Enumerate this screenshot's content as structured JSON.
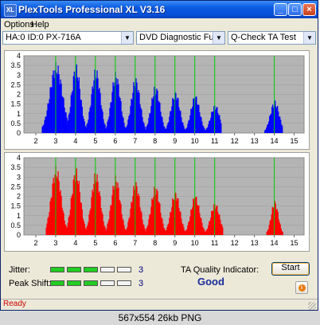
{
  "window": {
    "title": "PlexTools Professional XL V3.16",
    "icon_label": "XL"
  },
  "title_buttons": {
    "minimize": "_",
    "maximize": "□",
    "close": "×"
  },
  "menu": [
    "Options",
    "Help"
  ],
  "selectors": {
    "drive": "HA:0 ID:0  PX-716A",
    "function": "DVD Diagnostic Functions",
    "test": "Q-Check TA Test"
  },
  "colors": {
    "chart_bg": "#b4b4b4",
    "blue_series": "#0000ff",
    "red_series": "#ff0000",
    "peak_line": "#00cc00"
  },
  "chart_data": [
    {
      "type": "area",
      "color": "blue",
      "ylim": [
        0,
        4
      ],
      "xlim": [
        1.4,
        15.5
      ],
      "y_ticks": [
        "4",
        "3.5",
        "3",
        "2.5",
        "2",
        "1.5",
        "1",
        "0.5",
        "0"
      ],
      "x_ticks": [
        "2",
        "3",
        "4",
        "5",
        "6",
        "7",
        "8",
        "9",
        "10",
        "11",
        "12",
        "13",
        "14",
        "15"
      ],
      "peaks": [
        {
          "x": 3,
          "y": 3.7,
          "start": 2.3,
          "end": 3.55
        },
        {
          "x": 4,
          "y": 3.6,
          "start": 3.55,
          "end": 4.5
        },
        {
          "x": 5,
          "y": 3.4,
          "start": 4.5,
          "end": 5.5
        },
        {
          "x": 6,
          "y": 3.2,
          "start": 5.5,
          "end": 6.5
        },
        {
          "x": 7,
          "y": 2.9,
          "start": 6.5,
          "end": 7.5
        },
        {
          "x": 8,
          "y": 2.5,
          "start": 7.5,
          "end": 8.5
        },
        {
          "x": 9,
          "y": 2.2,
          "start": 8.5,
          "end": 9.5
        },
        {
          "x": 10,
          "y": 2.0,
          "start": 9.5,
          "end": 10.5
        },
        {
          "x": 11,
          "y": 1.5,
          "start": 10.5,
          "end": 11.3
        },
        {
          "x": 14,
          "y": 1.7,
          "start": 13.5,
          "end": 14.4
        }
      ],
      "peak_lines": [
        3,
        4,
        5,
        6,
        7,
        8,
        9,
        10,
        11,
        14
      ]
    },
    {
      "type": "area",
      "color": "red",
      "ylim": [
        0,
        4
      ],
      "xlim": [
        1.4,
        15.5
      ],
      "y_ticks": [
        "4",
        "3.5",
        "3",
        "2.5",
        "2",
        "1.5",
        "1",
        "0.5",
        "0"
      ],
      "x_ticks": [
        "2",
        "3",
        "4",
        "5",
        "6",
        "7",
        "8",
        "9",
        "10",
        "11",
        "12",
        "13",
        "14",
        "15"
      ],
      "peaks": [
        {
          "x": 3,
          "y": 3.6,
          "start": 2.5,
          "end": 3.55
        },
        {
          "x": 4,
          "y": 3.5,
          "start": 3.55,
          "end": 4.5
        },
        {
          "x": 5,
          "y": 3.3,
          "start": 4.5,
          "end": 5.5
        },
        {
          "x": 6,
          "y": 3.1,
          "start": 5.5,
          "end": 6.5
        },
        {
          "x": 7,
          "y": 2.8,
          "start": 6.5,
          "end": 7.5
        },
        {
          "x": 8,
          "y": 2.6,
          "start": 7.5,
          "end": 8.5
        },
        {
          "x": 9,
          "y": 2.3,
          "start": 8.5,
          "end": 9.5
        },
        {
          "x": 10,
          "y": 2.1,
          "start": 9.5,
          "end": 10.5
        },
        {
          "x": 11,
          "y": 1.7,
          "start": 10.5,
          "end": 11.4
        },
        {
          "x": 14,
          "y": 1.8,
          "start": 13.6,
          "end": 14.4
        }
      ],
      "peak_lines": [
        3,
        4,
        5,
        6,
        7,
        8,
        9,
        10,
        11,
        14
      ]
    }
  ],
  "metrics": {
    "jitter_label": "Jitter:",
    "jitter_value": "3",
    "jitter_level": 3,
    "peak_shift_label": "Peak Shift:",
    "peak_shift_value": "3",
    "peak_shift_level": 3,
    "segments": 5
  },
  "ta_quality": {
    "label": "TA Quality Indicator:",
    "value": "Good"
  },
  "start_button": "Start",
  "status": "Ready",
  "caption": "567x554 26kb PNG"
}
